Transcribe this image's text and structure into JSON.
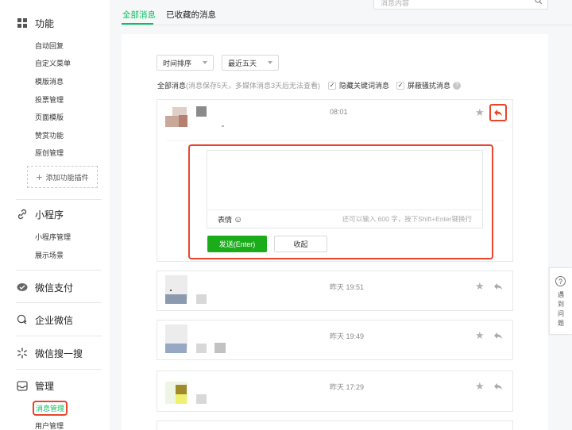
{
  "sidebar": {
    "sections": [
      {
        "title": "功能",
        "icon": "grid-icon",
        "items": [
          "自动回复",
          "自定义菜单",
          "模版消息",
          "投票管理",
          "页面模版",
          "赞赏功能",
          "原创管理"
        ]
      },
      {
        "title": "小程序",
        "icon": "link-icon",
        "items": [
          "小程序管理",
          "展示场景"
        ]
      },
      {
        "title": "微信支付",
        "icon": "wechat-pay-icon",
        "items": []
      },
      {
        "title": "企业微信",
        "icon": "work-wechat-icon",
        "items": []
      },
      {
        "title": "微信搜一搜",
        "icon": "search-sparkle-icon",
        "items": []
      },
      {
        "title": "管理",
        "icon": "inbox-icon",
        "items": [
          "消息管理",
          "用户管理"
        ]
      }
    ],
    "add_plugin_label": "添加功能插件",
    "active_item": "消息管理"
  },
  "tabs": [
    {
      "label": "全部消息",
      "active": true
    },
    {
      "label": "已收藏的消息",
      "active": false
    }
  ],
  "search": {
    "placeholder": "消息内容"
  },
  "filters": {
    "sort": "时间排序",
    "range": "最近五天",
    "summary_label": "全部消息",
    "summary_note": "(消息保存5天，多媒体消息3天后无法查看)",
    "hide_keyword_label": "隐藏关键词消息",
    "block_harass_label": "屏蔽骚扰消息",
    "hide_keyword_checked": true,
    "block_harass_checked": true
  },
  "messages": [
    {
      "time": "08:01",
      "reply_open": true
    },
    {
      "time": "昨天 19:51",
      "reply_open": false
    },
    {
      "time": "昨天 19:49",
      "reply_open": false
    },
    {
      "time": "昨天 17:29",
      "reply_open": false
    }
  ],
  "reply": {
    "emoji_label": "表情",
    "counter": "还可以输入 600 字，按下Shift+Enter键换行",
    "send_label": "发送(Enter)",
    "collapse_label": "收起"
  },
  "float_help": {
    "label": "遇到问题"
  },
  "colors": {
    "accent": "#07c160",
    "highlight": "#e8452c",
    "send_button": "#1aad19"
  }
}
